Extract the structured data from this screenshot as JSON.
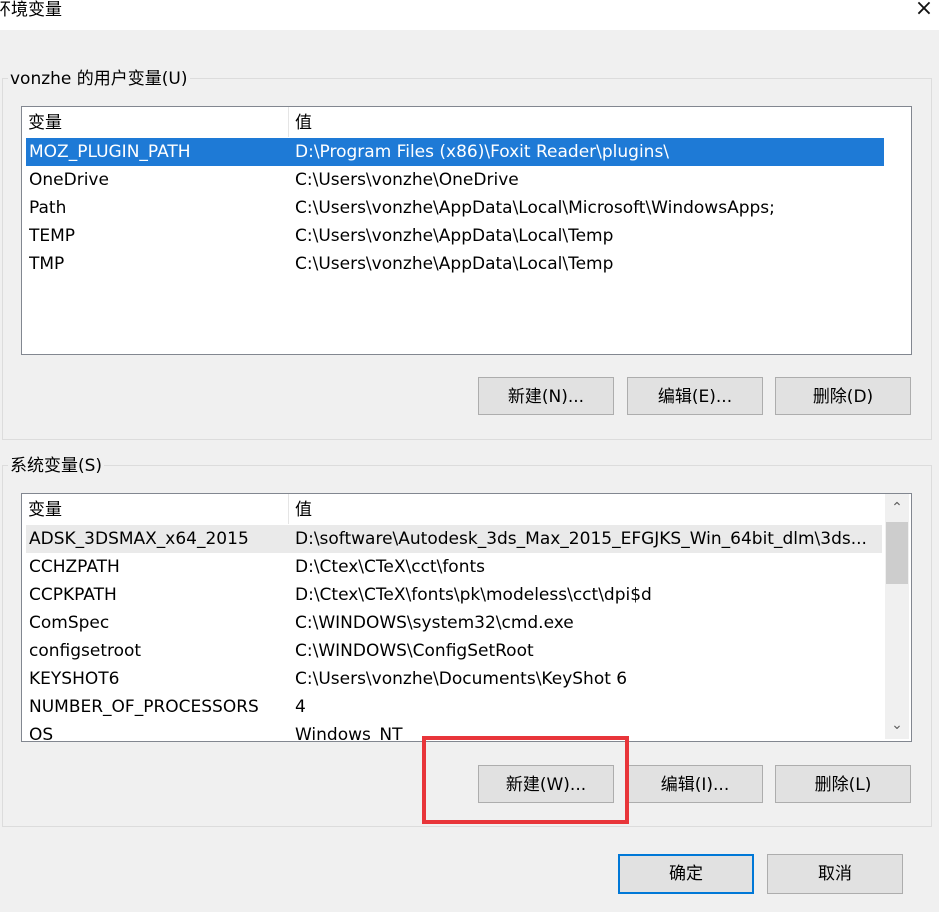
{
  "window": {
    "title": "环境变量",
    "close_glyph": "×"
  },
  "user_vars": {
    "label": "vonzhe 的用户变量(U)",
    "columns": [
      "变量",
      "值"
    ],
    "rows": [
      {
        "name": "MOZ_PLUGIN_PATH",
        "value": "D:\\Program Files (x86)\\Foxit Reader\\plugins\\",
        "selected": true
      },
      {
        "name": "OneDrive",
        "value": "C:\\Users\\vonzhe\\OneDrive"
      },
      {
        "name": "Path",
        "value": "C:\\Users\\vonzhe\\AppData\\Local\\Microsoft\\WindowsApps;"
      },
      {
        "name": "TEMP",
        "value": "C:\\Users\\vonzhe\\AppData\\Local\\Temp"
      },
      {
        "name": "TMP",
        "value": "C:\\Users\\vonzhe\\AppData\\Local\\Temp"
      }
    ],
    "buttons": {
      "new": "新建(N)...",
      "edit": "编辑(E)...",
      "delete": "删除(D)"
    }
  },
  "system_vars": {
    "label": "系统变量(S)",
    "columns": [
      "变量",
      "值"
    ],
    "rows": [
      {
        "name": "ADSK_3DSMAX_x64_2015",
        "value": "D:\\software\\Autodesk_3ds_Max_2015_EFGJKS_Win_64bit_dlm\\3ds...",
        "selected": true
      },
      {
        "name": "CCHZPATH",
        "value": "D:\\Ctex\\CTeX\\cct\\fonts"
      },
      {
        "name": "CCPKPATH",
        "value": "D:\\Ctex\\CTeX\\fonts\\pk\\modeless\\cct\\dpi$d"
      },
      {
        "name": "ComSpec",
        "value": "C:\\WINDOWS\\system32\\cmd.exe"
      },
      {
        "name": "configsetroot",
        "value": "C:\\WINDOWS\\ConfigSetRoot"
      },
      {
        "name": "KEYSHOT6",
        "value": "C:\\Users\\vonzhe\\Documents\\KeyShot 6"
      },
      {
        "name": "NUMBER_OF_PROCESSORS",
        "value": "4"
      },
      {
        "name": "OS",
        "value": "Windows_NT"
      }
    ],
    "buttons": {
      "new": "新建(W)...",
      "edit": "编辑(I)...",
      "delete": "删除(L)"
    },
    "scroll": {
      "up_glyph": "⌃",
      "down_glyph": "⌄"
    }
  },
  "footer": {
    "ok": "确定",
    "cancel": "取消"
  },
  "colors": {
    "selection": "#1e7ad6",
    "annotation": "#e8353a",
    "default_button_border": "#0078d7"
  }
}
